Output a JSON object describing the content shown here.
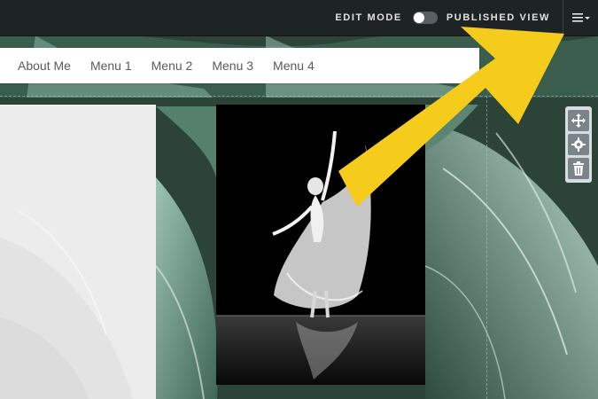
{
  "topbar": {
    "edit_mode_label": "EDIT MODE",
    "published_view_label": "PUBLISHED VIEW",
    "toggle_state": "edit",
    "menu_icon": "hamburger-icon"
  },
  "nav": {
    "items": [
      "About Me",
      "Menu 1",
      "Menu 2",
      "Menu 3",
      "Menu 4"
    ]
  },
  "toolbar": {
    "icons": [
      "move-icon",
      "gear-icon",
      "trash-icon"
    ]
  },
  "colors": {
    "topbar_bg": "#1e2326",
    "arrow": "#f6cc1c",
    "leaf_dark": "#2f4a3c",
    "toolbar_btn": "#7b848a"
  }
}
